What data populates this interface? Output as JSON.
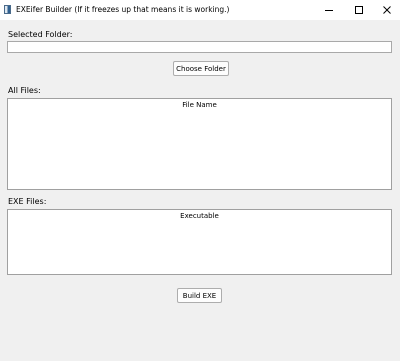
{
  "window": {
    "title": "EXEifer Builder (If it freezes up that means it is working.)"
  },
  "folder": {
    "label": "Selected Folder:",
    "value": "",
    "choose_button": "Choose Folder"
  },
  "all_files": {
    "label": "All Files:",
    "column_header": "File Name"
  },
  "exe_files": {
    "label": "EXE Files:",
    "column_header": "Executable"
  },
  "build_button": "Build EXE"
}
